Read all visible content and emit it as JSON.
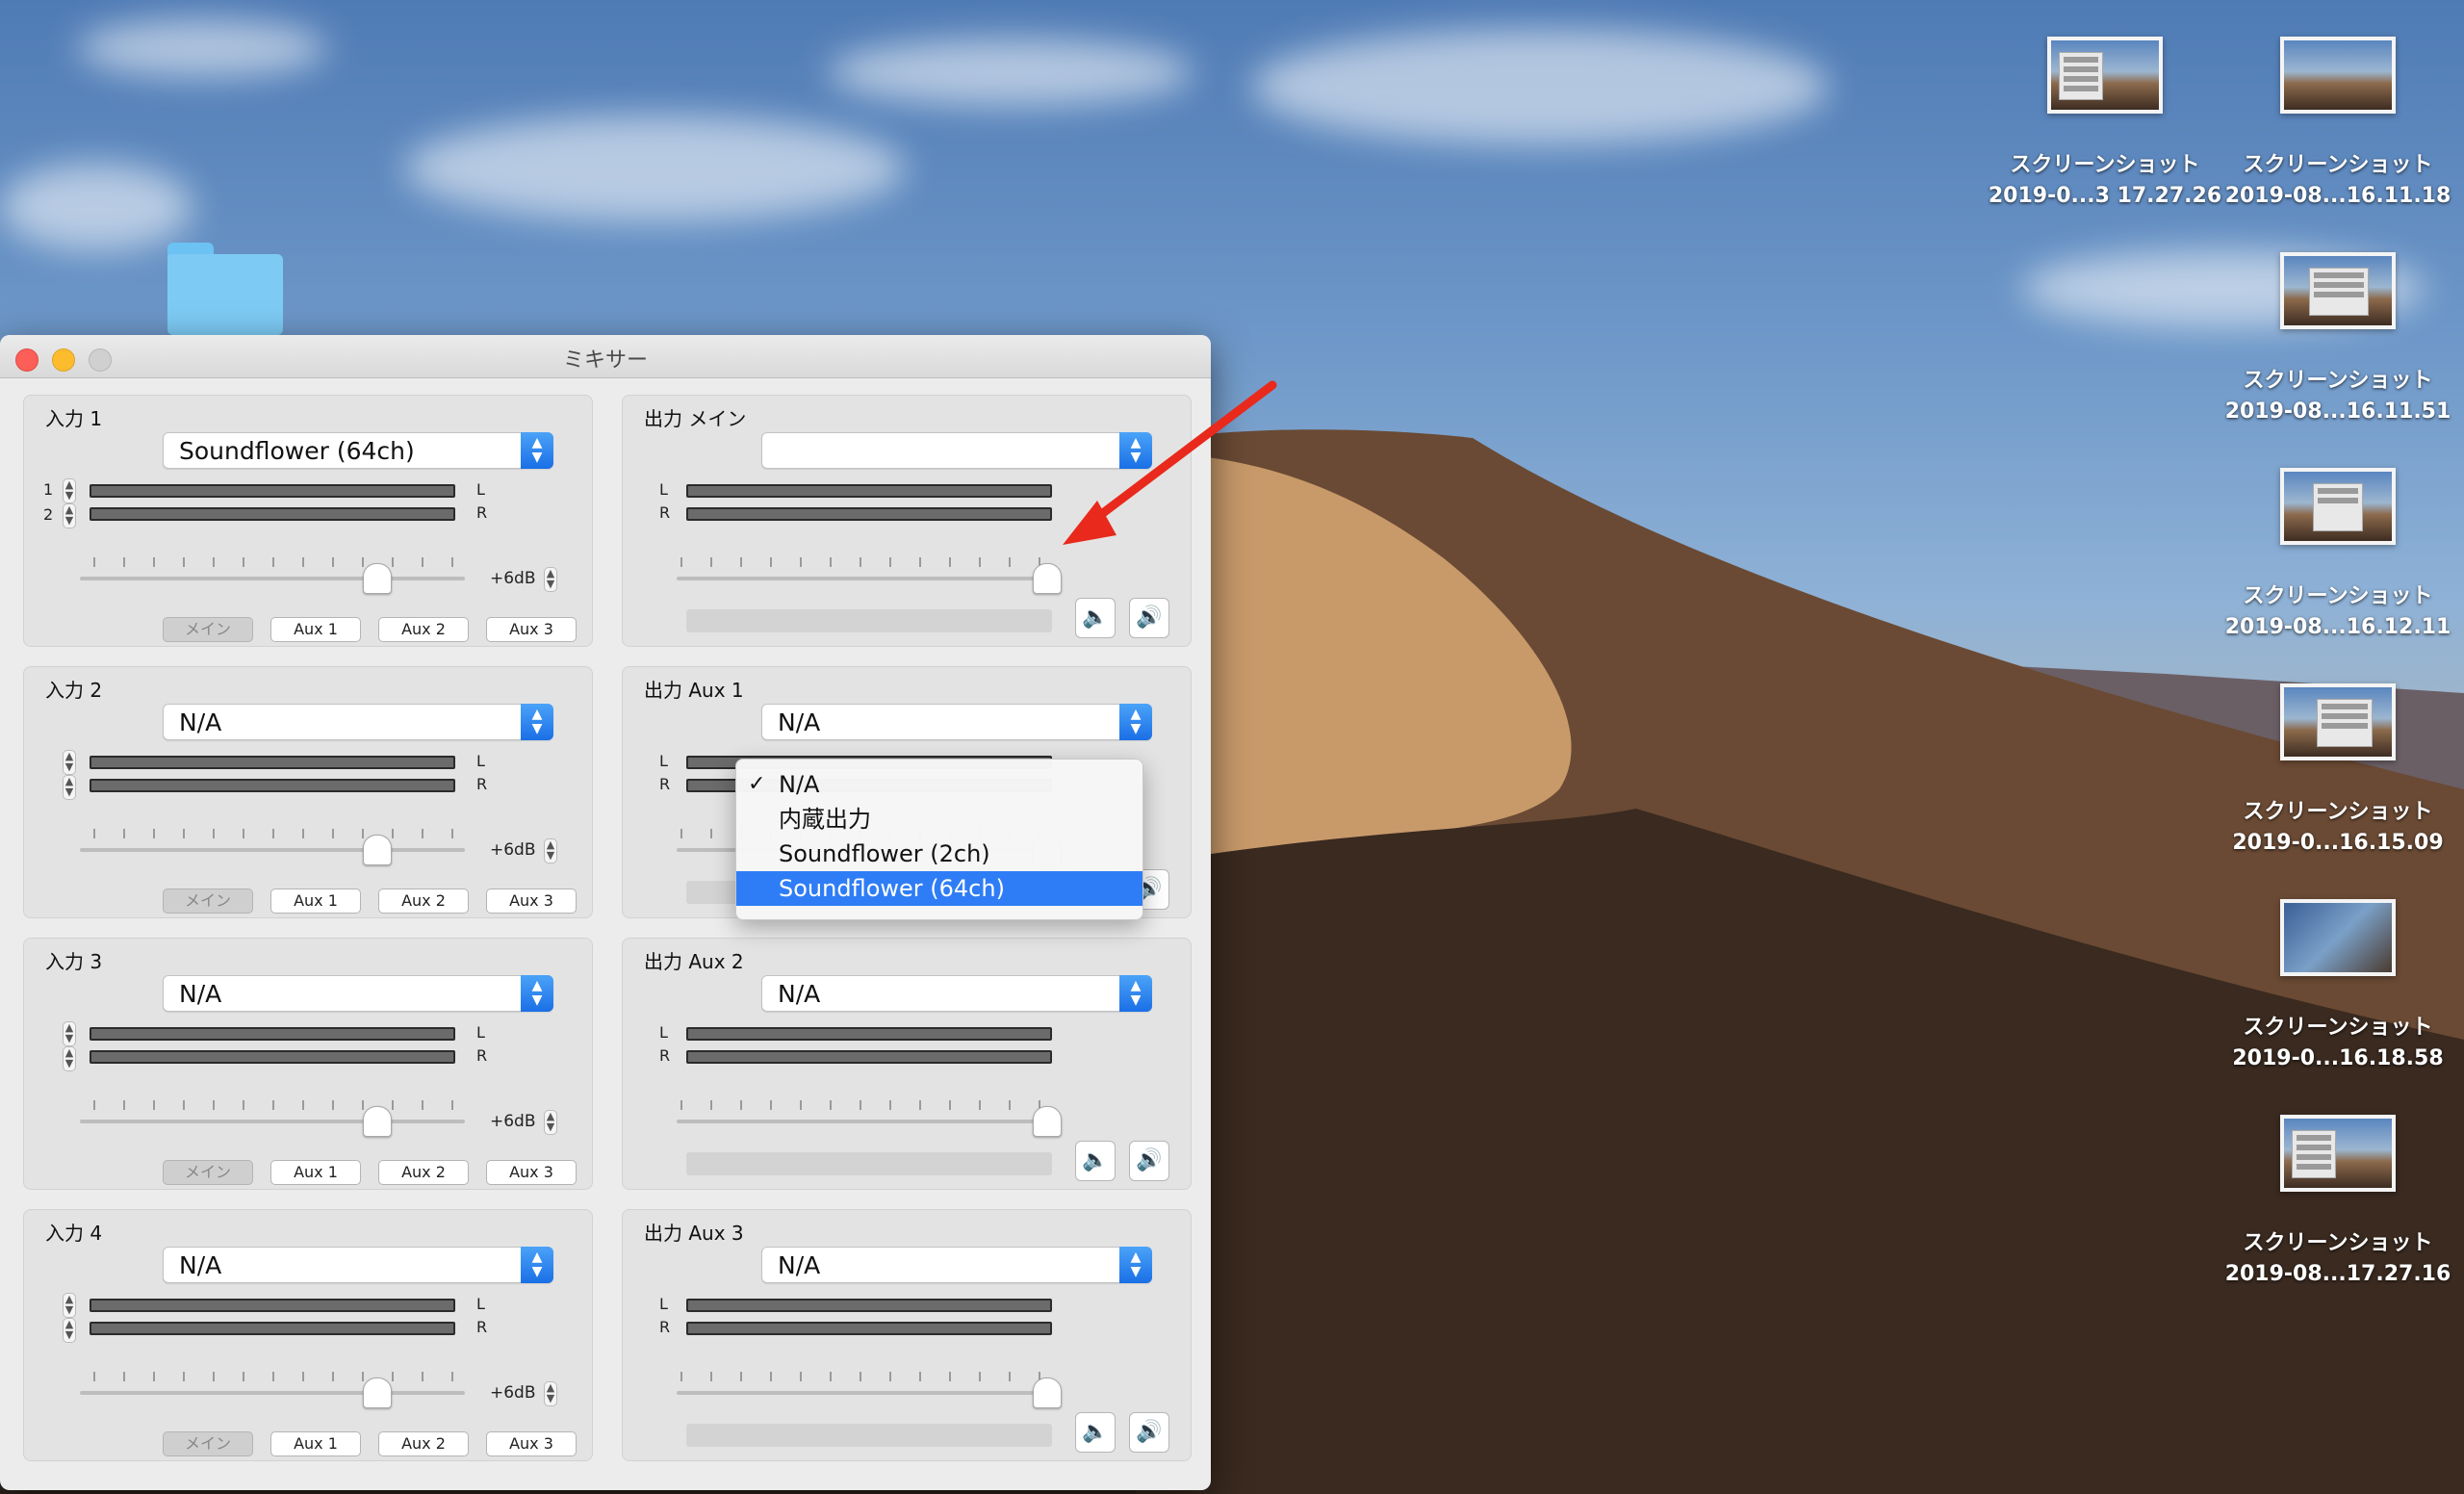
{
  "window": {
    "title": "ミキサー"
  },
  "inputs": [
    {
      "title": "入力 1",
      "device": "Soundflower (64ch)",
      "ch1": "1",
      "ch2": "2",
      "gain": "+6dB",
      "routes": [
        "メイン",
        "Aux 1",
        "Aux 2",
        "Aux 3"
      ],
      "selected_route": 0
    },
    {
      "title": "入力 2",
      "device": "N/A",
      "ch1": "",
      "ch2": "",
      "gain": "+6dB",
      "routes": [
        "メイン",
        "Aux 1",
        "Aux 2",
        "Aux 3"
      ],
      "selected_route": 0
    },
    {
      "title": "入力 3",
      "device": "N/A",
      "ch1": "",
      "ch2": "",
      "gain": "+6dB",
      "routes": [
        "メイン",
        "Aux 1",
        "Aux 2",
        "Aux 3"
      ],
      "selected_route": 0
    },
    {
      "title": "入力 4",
      "device": "N/A",
      "ch1": "",
      "ch2": "",
      "gain": "+6dB",
      "routes": [
        "メイン",
        "Aux 1",
        "Aux 2",
        "Aux 3"
      ],
      "selected_route": 0
    }
  ],
  "outputs": [
    {
      "title": "出力 メイン",
      "device": ""
    },
    {
      "title": "出力 Aux 1",
      "device": "N/A"
    },
    {
      "title": "出力 Aux 2",
      "device": "N/A"
    },
    {
      "title": "出力 Aux 3",
      "device": "N/A"
    }
  ],
  "labels": {
    "left": "L",
    "right": "R"
  },
  "dropdown": {
    "items": [
      "N/A",
      "内蔵出力",
      "Soundflower (2ch)",
      "Soundflower (64ch)"
    ],
    "checked_index": 0,
    "highlighted_index": 3
  },
  "desktop_icons": [
    {
      "line1": "スクリーンショット",
      "line2": "2019-0...3 17.27.26"
    },
    {
      "line1": "スクリーンショット",
      "line2": "2019-08...16.11.18"
    },
    {
      "line1": "スクリーンショット",
      "line2": "2019-08...16.11.51"
    },
    {
      "line1": "スクリーンショット",
      "line2": "2019-08...16.12.11"
    },
    {
      "line1": "スクリーンショット",
      "line2": "2019-0...16.15.09"
    },
    {
      "line1": "スクリーンショット",
      "line2": "2019-0...16.18.58"
    },
    {
      "line1": "スクリーンショット",
      "line2": "2019-08...17.27.16"
    }
  ],
  "colors": {
    "accent": "#2f7df6",
    "arrow": "#e8291c",
    "folder": "#7dcbf5"
  },
  "icons": {
    "speaker_low": "🔈",
    "speaker_high": "🔊",
    "check": "✓"
  }
}
